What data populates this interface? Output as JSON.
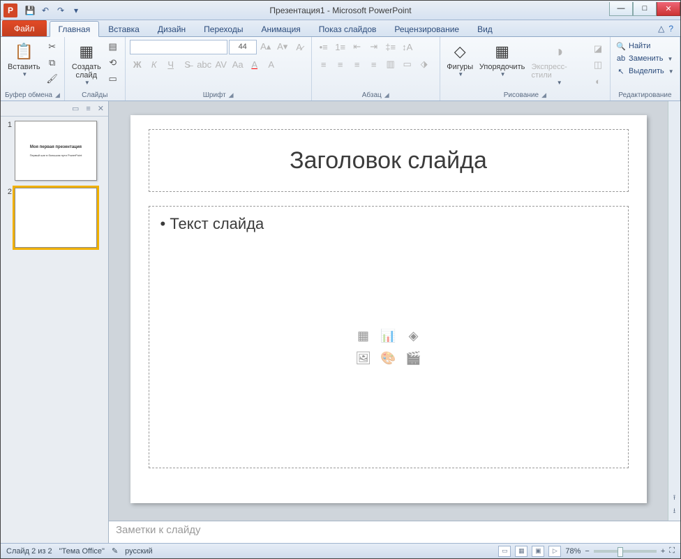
{
  "title": "Презентация1 - Microsoft PowerPoint",
  "app_letter": "P",
  "tabs": {
    "file": "Файл",
    "home": "Главная",
    "insert": "Вставка",
    "design": "Дизайн",
    "transitions": "Переходы",
    "animations": "Анимация",
    "slideshow": "Показ слайдов",
    "review": "Рецензирование",
    "view": "Вид"
  },
  "groups": {
    "clipboard": "Буфер обмена",
    "slides": "Слайды",
    "font": "Шрифт",
    "paragraph": "Абзац",
    "drawing": "Рисование",
    "editing": "Редактирование"
  },
  "ribbon": {
    "paste": "Вставить",
    "new_slide": "Создать\nслайд",
    "font_size": "44",
    "shapes": "Фигуры",
    "arrange": "Упорядочить",
    "quick_styles": "Экспресс-стили",
    "find": "Найти",
    "replace": "Заменить",
    "select": "Выделить"
  },
  "thumb1": {
    "title": "Моя первая презентация",
    "sub": "Первый шаг в большом пути PowerPoint"
  },
  "slide": {
    "title_placeholder": "Заголовок слайда",
    "body_placeholder": "Текст слайда"
  },
  "notes_placeholder": "Заметки к слайду",
  "status": {
    "slide_info": "Слайд 2 из 2",
    "theme": "\"Тема Office\"",
    "lang": "русский",
    "zoom": "78%"
  }
}
